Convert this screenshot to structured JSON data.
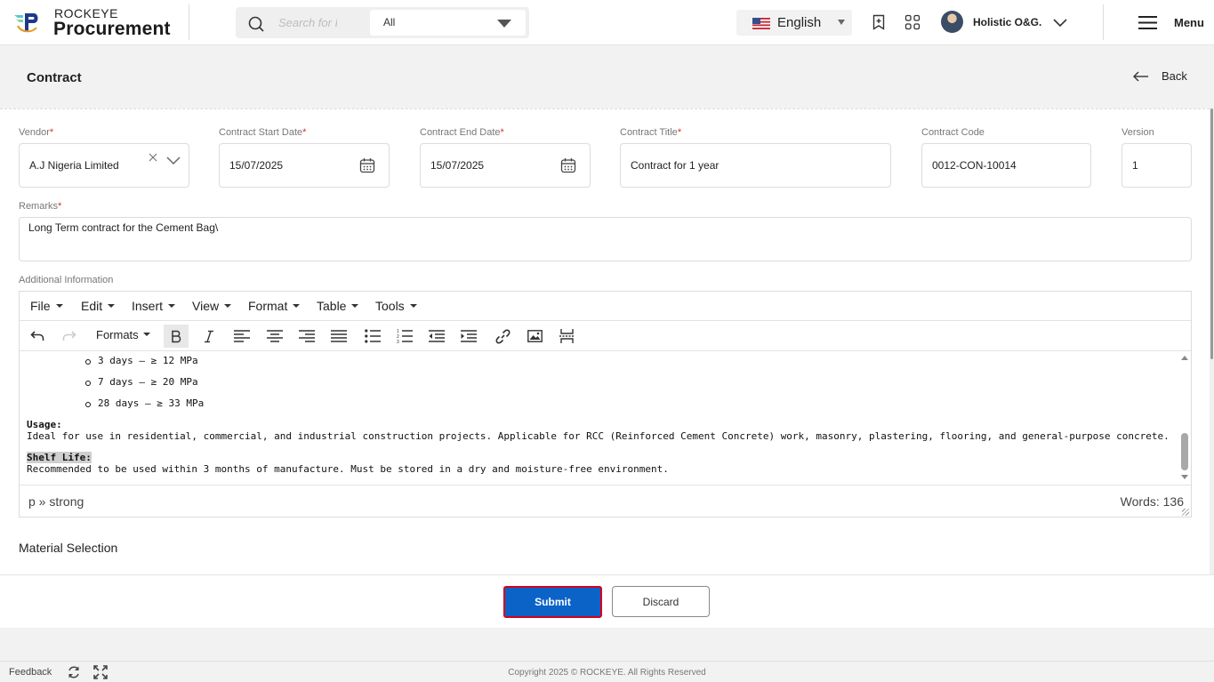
{
  "header": {
    "brand_small": "ROCKEYE",
    "brand_big": "Procurement",
    "search_placeholder": "Search for F",
    "search_scope": "All",
    "language": "English",
    "user_name": "Holistic O&G.",
    "menu_label": "Menu",
    "icons": [
      "bookmark-icon",
      "apps-grid-icon",
      "hamburger-icon",
      "search-icon",
      "us-flag-icon"
    ]
  },
  "page": {
    "title": "Contract",
    "back_label": "Back"
  },
  "form": {
    "vendor": {
      "label": "Vendor",
      "value": "A.J Nigeria Limited"
    },
    "start_date": {
      "label": "Contract Start Date",
      "value": "15/07/2025"
    },
    "end_date": {
      "label": "Contract End Date",
      "value": "15/07/2025"
    },
    "title": {
      "label": "Contract Title",
      "value": "Contract for 1 year"
    },
    "code": {
      "label": "Contract Code",
      "value": "0012-CON-10014"
    },
    "version": {
      "label": "Version",
      "value": "1"
    },
    "remarks": {
      "label": "Remarks",
      "value": "Long Term contract for the Cement Bag\\"
    },
    "required_mark": "*"
  },
  "editor": {
    "label": "Additional Information",
    "menus": [
      "File",
      "Edit",
      "Insert",
      "View",
      "Format",
      "Table",
      "Tools"
    ],
    "formats_label": "Formats",
    "content": {
      "bullets": [
        "3 days – ≥ 12 MPa",
        "7 days – ≥ 20 MPa",
        "28 days – ≥ 33 MPa"
      ],
      "usage_heading": "Usage:",
      "usage_text": "Ideal for use in residential, commercial, and industrial construction projects. Applicable for RCC (Reinforced Cement Concrete) work, masonry, plastering, flooring, and general-purpose concrete.",
      "shelf_heading": "Shelf Life:",
      "shelf_text": "Recommended to be used within 3 months of manufacture. Must be stored in a dry and moisture-free environment."
    },
    "path": "p » strong",
    "word_count": "Words: 136"
  },
  "material_section": "Material Selection",
  "actions": {
    "submit": "Submit",
    "discard": "Discard"
  },
  "footer": {
    "feedback": "Feedback",
    "copyright": "Copyright 2025 © ROCKEYE. All Rights Reserved"
  },
  "colors": {
    "primary": "#0b63c8",
    "highlight_border": "#d6001c",
    "required": "#d32f2f"
  }
}
